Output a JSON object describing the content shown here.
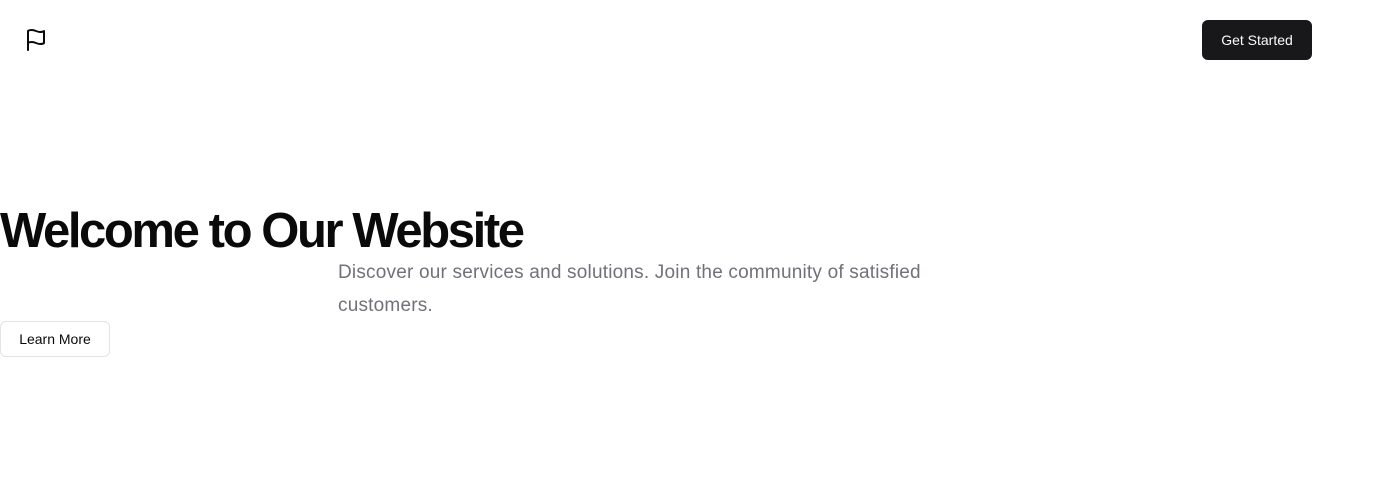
{
  "header": {
    "logo_icon": "flag-icon",
    "cta_label": "Get Started"
  },
  "hero": {
    "title": "Welcome to Our Website",
    "subtitle": "Discover our services and solutions. Join the community of satisfied customers.",
    "secondary_label": "Learn More"
  },
  "colors": {
    "background": "#ffffff",
    "primary_button": "#18181b",
    "primary_button_text": "#fafafa",
    "title_text": "#0a0a0a",
    "subtitle_text": "#71717a",
    "secondary_border": "#e4e4e7"
  }
}
